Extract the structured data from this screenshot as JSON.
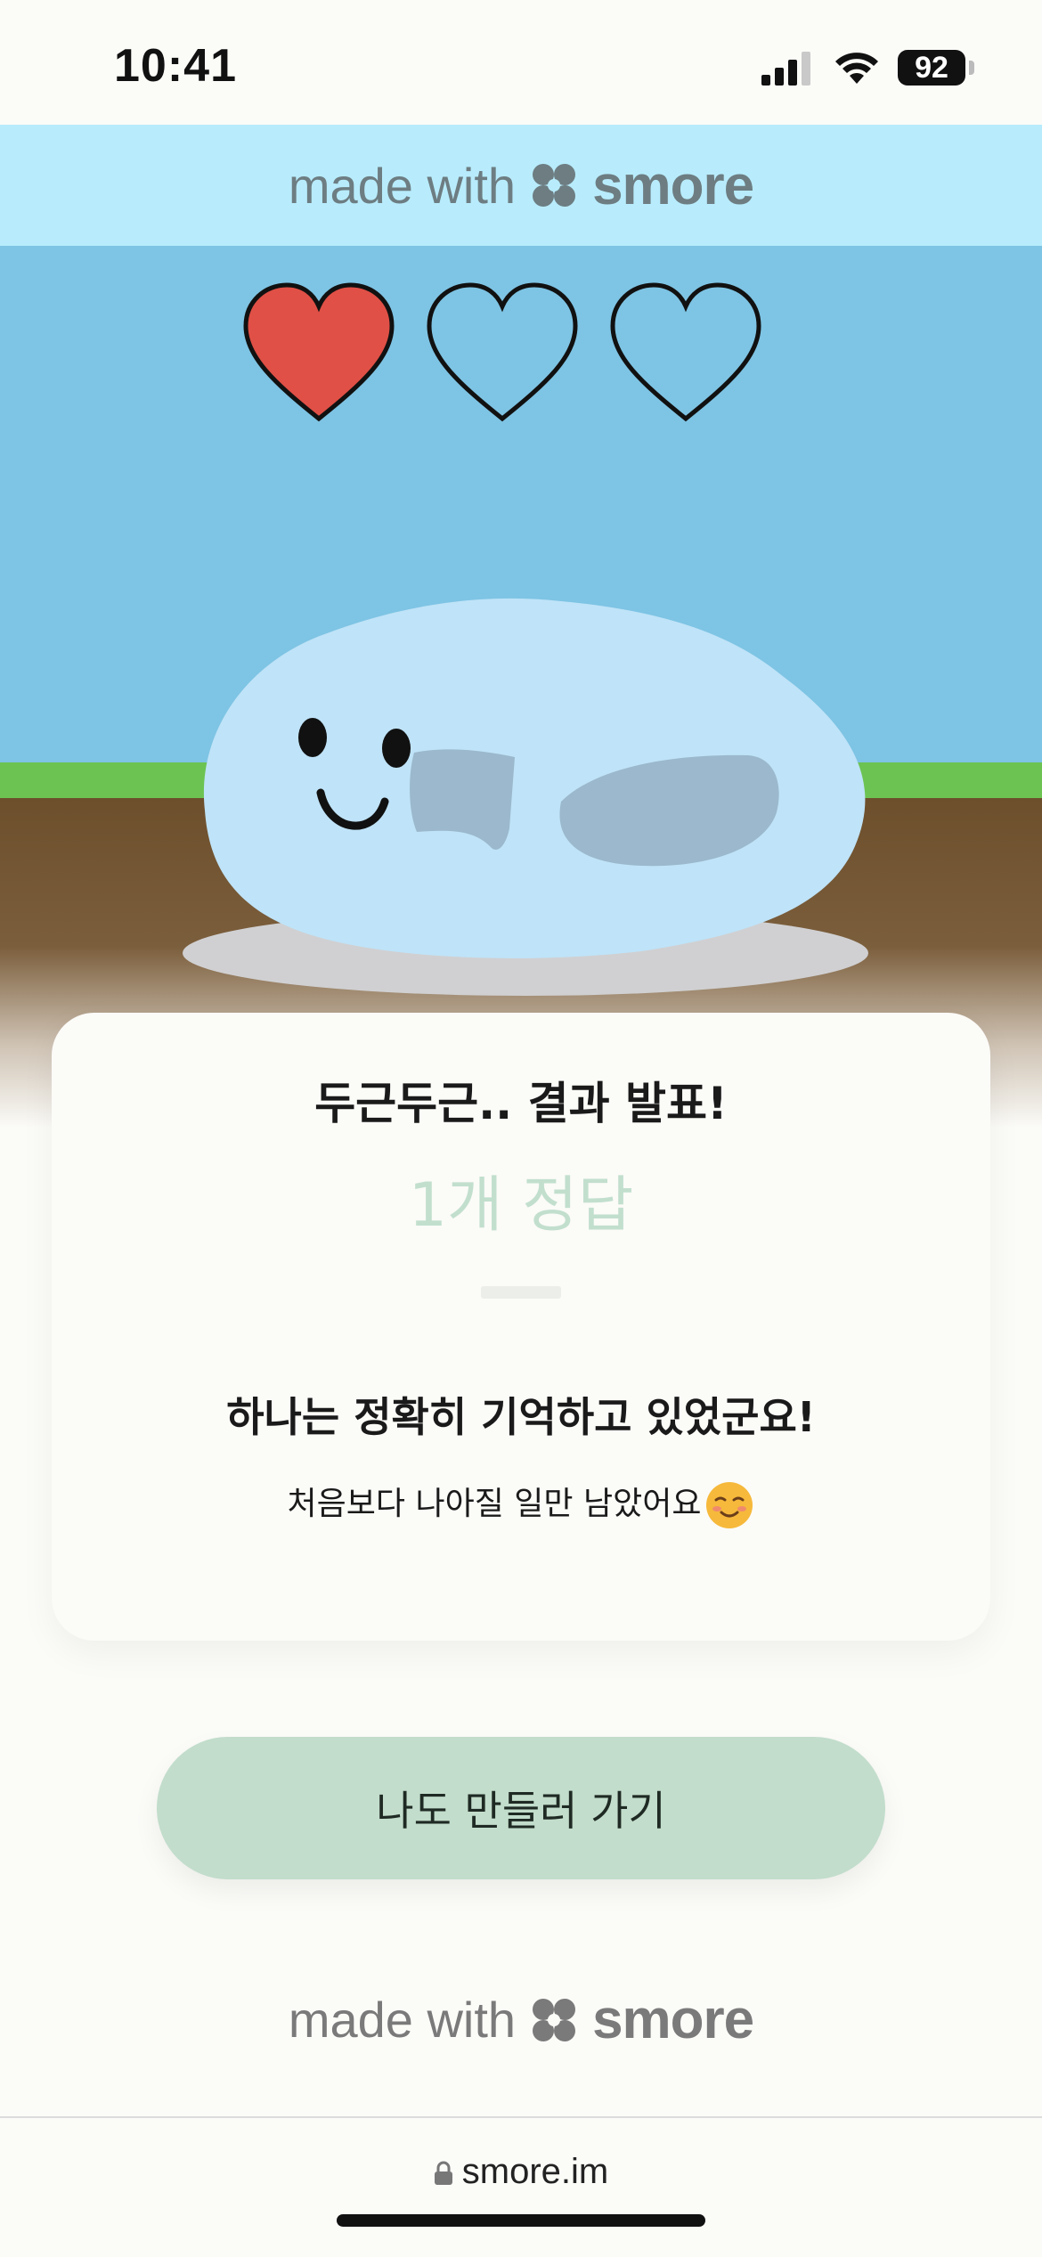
{
  "status_bar": {
    "time": "10:41",
    "battery": "92"
  },
  "banner": {
    "made_with": "made with",
    "brand": "smore"
  },
  "hearts": {
    "filled": 1,
    "total": 3,
    "filled_color": "#e05046",
    "empty_color": "#7ec4e4"
  },
  "result": {
    "title": "두근두근.. 결과 발표!",
    "score": "1개 정답",
    "headline": "하나는 정확히 기억하고 있었군요!",
    "subtext": "처음보다 나아질 일만 남았어요"
  },
  "cta": {
    "label": "나도 만들러 가기"
  },
  "footer": {
    "made_with": "made with",
    "brand": "smore"
  },
  "browser": {
    "url": "smore.im"
  },
  "colors": {
    "banner_bg": "#b8ecfc",
    "sky": "#7ec4e4",
    "grass": "#6cc352",
    "cta_bg": "#c2ddcb",
    "score_text": "#c2dfcd"
  }
}
